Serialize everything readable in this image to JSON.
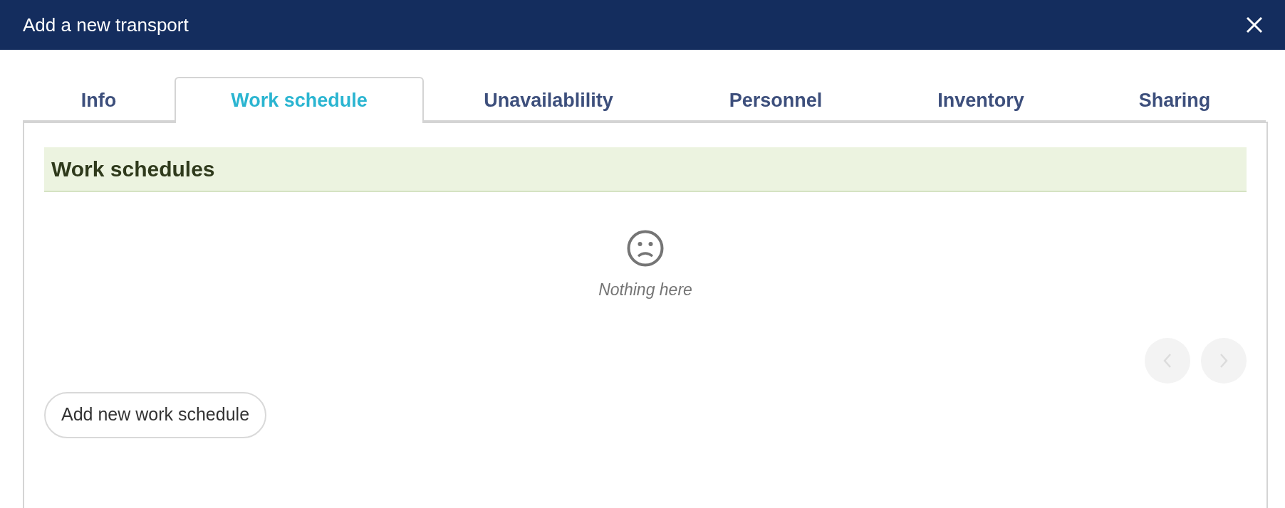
{
  "window": {
    "title": "Add a new transport"
  },
  "tabs": [
    {
      "label": "Info",
      "selected": false
    },
    {
      "label": "Work schedule",
      "selected": true
    },
    {
      "label": "Unavailablility",
      "selected": false
    },
    {
      "label": "Personnel",
      "selected": false
    },
    {
      "label": "Inventory",
      "selected": false
    },
    {
      "label": "Sharing",
      "selected": false
    }
  ],
  "section": {
    "title": "Work schedules",
    "empty_message": "Nothing here"
  },
  "pager": {
    "previous": {
      "disabled": true
    },
    "next": {
      "disabled": true
    }
  },
  "add_button": "Add new work schedule"
}
